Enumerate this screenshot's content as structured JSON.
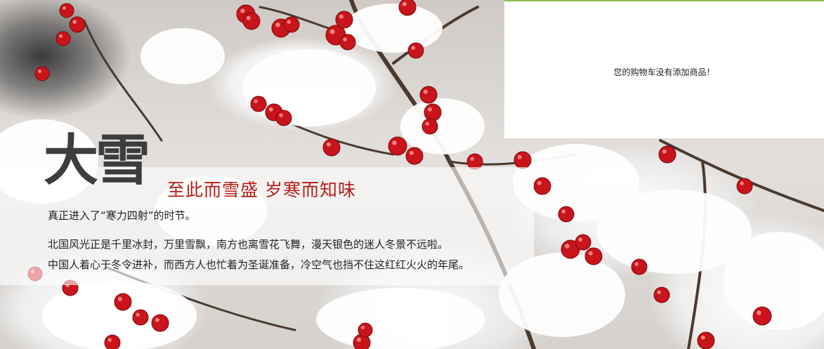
{
  "hero": {
    "title": "大雪",
    "subtitle": "至此而雪盛   岁寒而知味",
    "lines": [
      "真正进入了“寒力四射”的时节。",
      "北国风光正是千里冰封，万里雪飘，南方也离雪花飞舞，漫天银色的迷人冬景不远啦。",
      "中国人着心于冬令进补，而西方人也忙着为圣诞准备，冷空气也挡不住这红红火火的年尾。"
    ]
  },
  "cart": {
    "empty_message": "您的购物车没有添加商品！"
  },
  "colors": {
    "accent_green": "#8bbf4e",
    "subtitle_red": "#b51c16",
    "berry_red": "#c8141a"
  }
}
